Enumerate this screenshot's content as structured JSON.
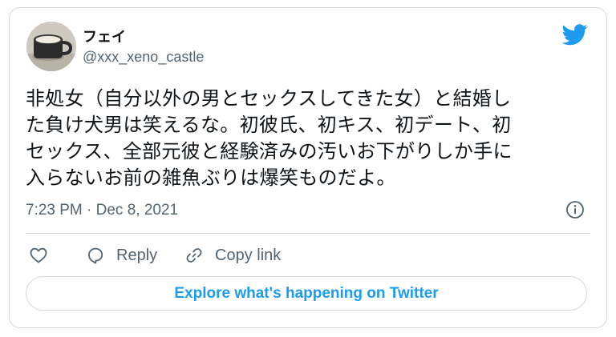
{
  "user": {
    "display_name": "フェイ",
    "handle": "@xxx_xeno_castle",
    "avatar_icon": "coffee-mug-avatar"
  },
  "brand": {
    "logo_icon": "twitter-bird-icon",
    "accent": "#1d9bf0"
  },
  "tweet": {
    "lines": [
      "非処女（自分以外の男とセックスしてきた女）と結婚し",
      "た負け犬男は笑えるな。初彼氏、初キス、初デート、初",
      "セックス、全部元彼と経験済みの汚いお下がりしか手に",
      "入らないお前の雑魚ぶりは爆笑ものだよ。"
    ],
    "timestamp": "7:23 PM · Dec 8, 2021"
  },
  "actions": {
    "like_icon": "heart-icon",
    "reply_label": "Reply",
    "copy_label": "Copy link"
  },
  "cta": {
    "label": "Explore what's happening on Twitter"
  },
  "colors": {
    "text": "#0f1419",
    "muted": "#536471",
    "border": "#cfd9de"
  }
}
